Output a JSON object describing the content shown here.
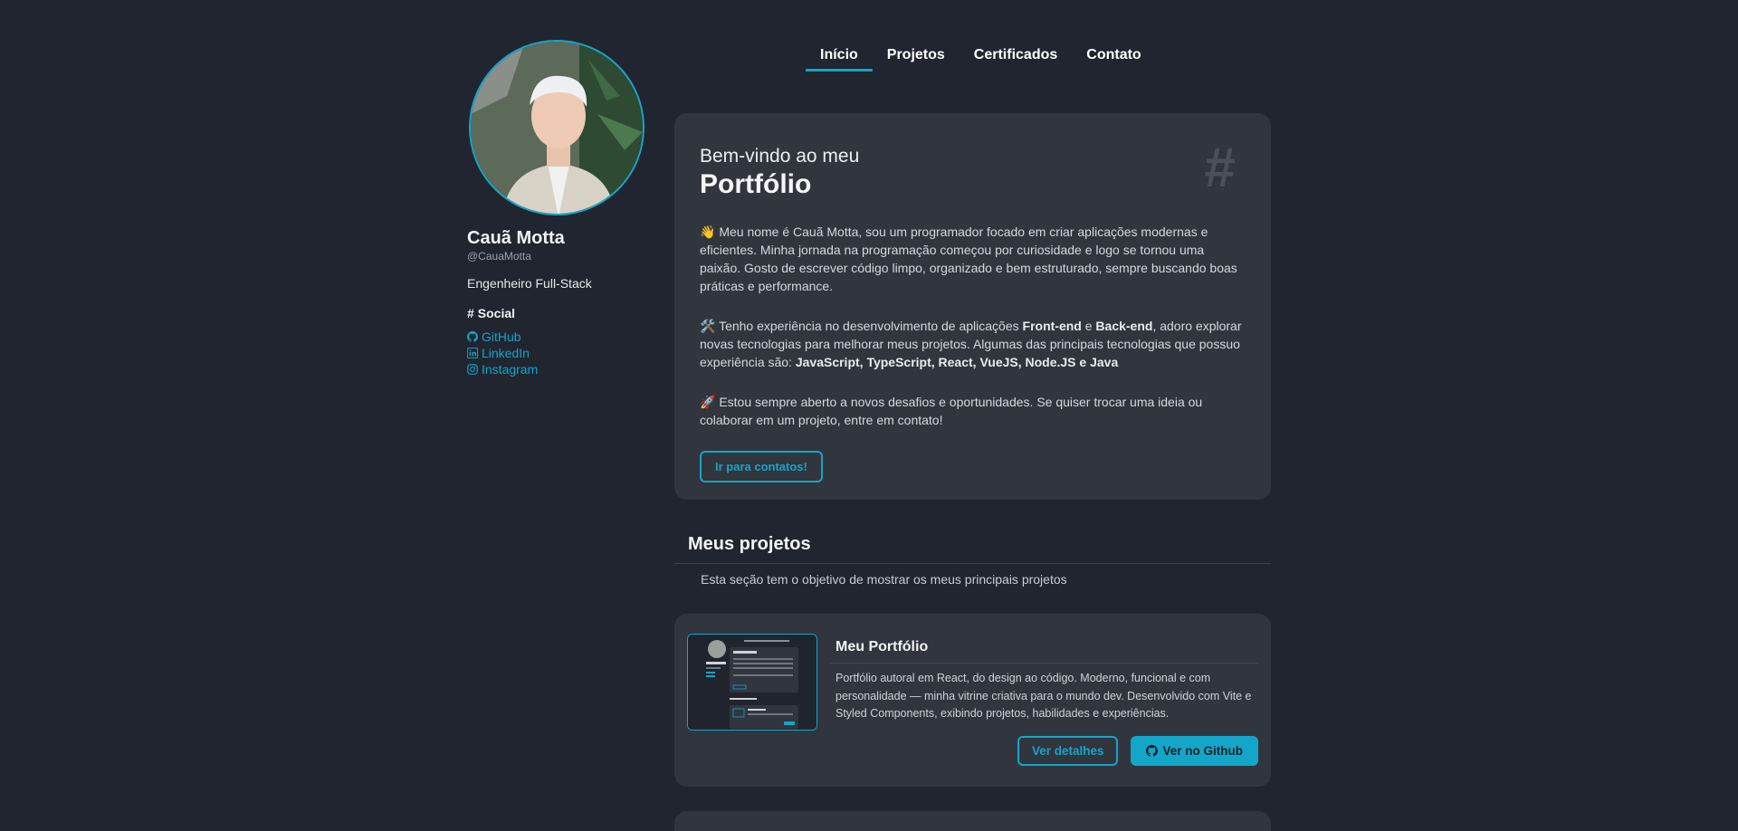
{
  "profile": {
    "name": "Cauã Motta",
    "handle": "@CauaMotta",
    "role": "Engenheiro Full-Stack",
    "social_title": "Social",
    "social_links": [
      {
        "label": "GitHub",
        "icon": "github-icon"
      },
      {
        "label": "LinkedIn",
        "icon": "linkedin-icon"
      },
      {
        "label": "Instagram",
        "icon": "instagram-icon"
      }
    ]
  },
  "nav": {
    "items": [
      "Início",
      "Projetos",
      "Certificados",
      "Contato"
    ],
    "active": "Início"
  },
  "hero": {
    "welcome": "Bem-vindo ao meu",
    "title": "Portfólio",
    "icon": "hash-icon",
    "p1": "👋 Meu nome é Cauã Motta, sou um programador focado em criar aplicações modernas e eficientes. Minha jornada na programação começou por curiosidade e logo se tornou uma paixão. Gosto de escrever código limpo, organizado e bem estruturado, sempre buscando boas práticas e performance.",
    "p2_a": "🛠️ Tenho experiência no desenvolvimento de aplicações ",
    "p2_b": "Front-end",
    "p2_c": " e ",
    "p2_d": "Back-end",
    "p2_e": ", adoro explorar novas tecnologias para melhorar meus projetos. Algumas das principais tecnologias que possuo experiência são: ",
    "p2_f": "JavaScript, TypeScript, React, VueJS, Node.JS e Java",
    "p3": "🚀 Estou sempre aberto a novos desafios e oportunidades. Se quiser trocar uma ideia ou colaborar em um projeto, entre em contato!",
    "cta": "Ir para contatos!"
  },
  "projects_section": {
    "title": "Meus projetos",
    "description": "Esta seção tem o objetivo de mostrar os meus principais projetos",
    "items": [
      {
        "title": "Meu Portfólio",
        "description": "Portfólio autoral em React, do design ao código. Moderno, funcional e com personalidade — minha vitrine criativa para o mundo dev. Desenvolvido com Vite e Styled Components, exibindo projetos, habilidades e experiências.",
        "details_label": "Ver detalhes",
        "github_label": "Ver no Github"
      }
    ]
  },
  "colors": {
    "accent": "#13a6c9",
    "background": "#202530",
    "card": "#31353e"
  }
}
